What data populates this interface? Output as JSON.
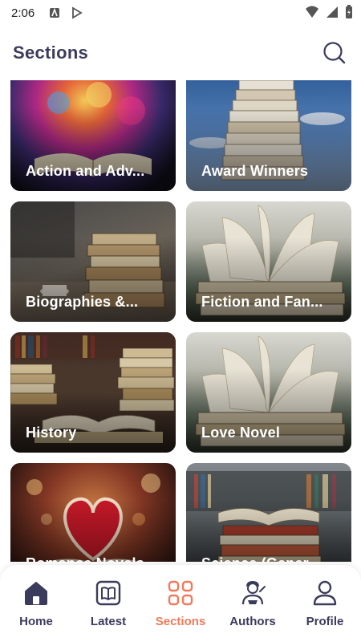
{
  "status_bar": {
    "time": "2:06"
  },
  "header": {
    "title": "Sections",
    "search_icon": "search-icon"
  },
  "sections": [
    {
      "label": "Action and Adv...",
      "theme": "colorful-explosion"
    },
    {
      "label": "Award Winners",
      "theme": "sky-stack"
    },
    {
      "label": "Biographies &...",
      "theme": "desk-stack"
    },
    {
      "label": "Fiction and Fan...",
      "theme": "open-pages"
    },
    {
      "label": "History",
      "theme": "library-stacks"
    },
    {
      "label": "Love Novel",
      "theme": "open-pages"
    },
    {
      "label": "Romance Novels",
      "theme": "heart-bokeh"
    },
    {
      "label": "Science (Gener...",
      "theme": "shelf-stack"
    }
  ],
  "bottom_nav": {
    "items": [
      {
        "label": "Home",
        "icon": "home-icon",
        "active": false
      },
      {
        "label": "Latest",
        "icon": "book-icon",
        "active": false
      },
      {
        "label": "Sections",
        "icon": "grid-icon",
        "active": true
      },
      {
        "label": "Authors",
        "icon": "author-icon",
        "active": false
      },
      {
        "label": "Profile",
        "icon": "profile-icon",
        "active": false
      }
    ]
  },
  "colors": {
    "accent": "#f07a5a",
    "primary_text": "#3b3b5c"
  }
}
